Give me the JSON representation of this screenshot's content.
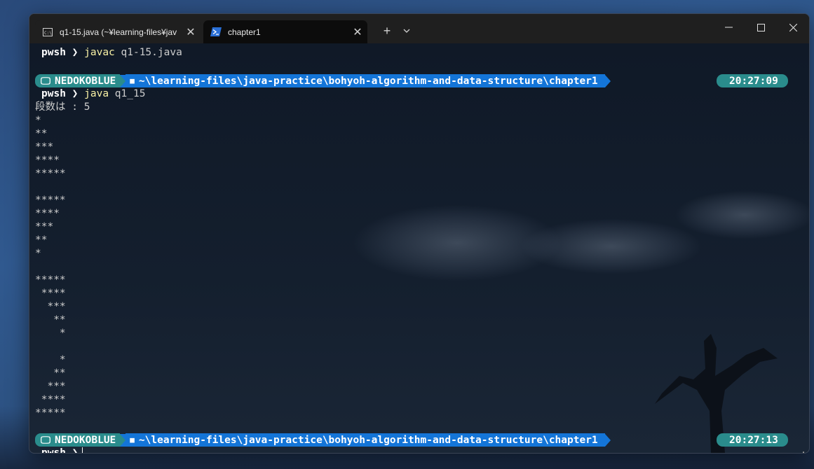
{
  "tabs": [
    {
      "title": "q1-15.java (~¥learning-files¥jav",
      "icon": "cmd-icon",
      "active": false
    },
    {
      "title": "chapter1",
      "icon": "powershell-icon",
      "active": true
    }
  ],
  "toolbar": {
    "new_tab": "+",
    "dropdown": "⌄"
  },
  "window_controls": {
    "minimize": "—",
    "maximize": "☐",
    "close": "✕"
  },
  "colors": {
    "host_segment": "#2a8c8c",
    "path_segment": "#1475d8",
    "command": "#f9f1a5",
    "terminal_bg": "#0c0c0c"
  },
  "terminal": {
    "prompt1": {
      "shell": "pwsh",
      "arrow": "❯",
      "cmd": "javac",
      "args": " q1-15.java"
    },
    "status1": {
      "host": "NEDOKOBLUE",
      "path": "~\\learning-files\\java-practice\\bohyoh-algorithm-and-data-structure\\chapter1",
      "time": "20:27:09"
    },
    "prompt2": {
      "shell": "pwsh",
      "arrow": "❯",
      "cmd": "java",
      "args": " q1_15"
    },
    "output": [
      "段数は : 5",
      "*",
      "**",
      "***",
      "****",
      "*****",
      "",
      "*****",
      "****",
      "***",
      "**",
      "*",
      "",
      "*****",
      " ****",
      "  ***",
      "   **",
      "    *",
      "",
      "    *",
      "   **",
      "  ***",
      " ****",
      "*****"
    ],
    "status2": {
      "host": "NEDOKOBLUE",
      "path": "~\\learning-files\\java-practice\\bohyoh-algorithm-and-data-structure\\chapter1",
      "time": "20:27:13"
    },
    "prompt3": {
      "shell": "pwsh",
      "arrow": "❯"
    }
  }
}
